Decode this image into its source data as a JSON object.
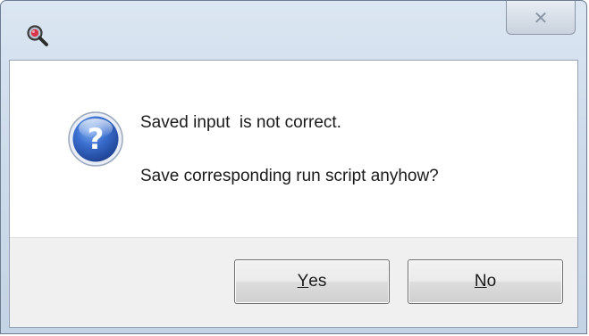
{
  "window": {
    "app_icon": "magnifier-icon",
    "close_glyph": "✕"
  },
  "message": {
    "icon": "question-icon",
    "line1": "Saved input  is not correct.",
    "line2": "Save corresponding run script anyhow?"
  },
  "buttons": {
    "yes": {
      "mnemonic": "Y",
      "rest": "es"
    },
    "no": {
      "mnemonic": "N",
      "rest": "o"
    }
  },
  "colors": {
    "question_icon_blue": "#2a58b8",
    "titlebar": "#cfdceb",
    "button_area": "#f0f0f0"
  }
}
